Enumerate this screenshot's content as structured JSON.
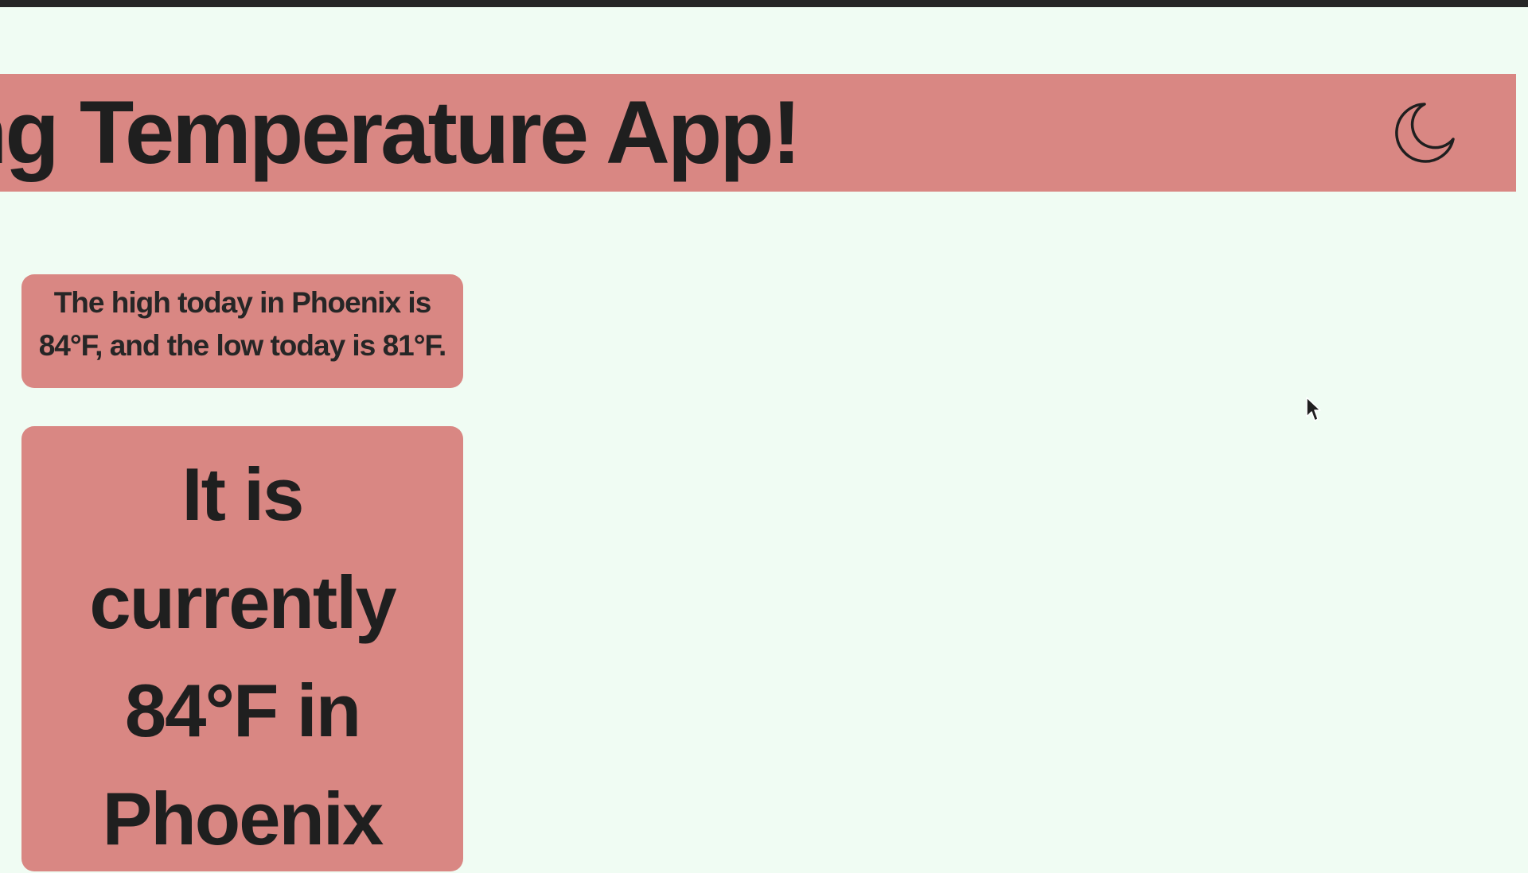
{
  "header": {
    "title": "ing Temperature App!",
    "theme_toggle_icon": "moon-icon"
  },
  "cards": {
    "summary": "The high today in Phoenix is 84°F, and the low today is 81°F.",
    "current": "It is currently 84°F in Phoenix"
  },
  "colors": {
    "background": "#f0fcf3",
    "accent": "#d98783",
    "text": "#1f1f1f"
  }
}
